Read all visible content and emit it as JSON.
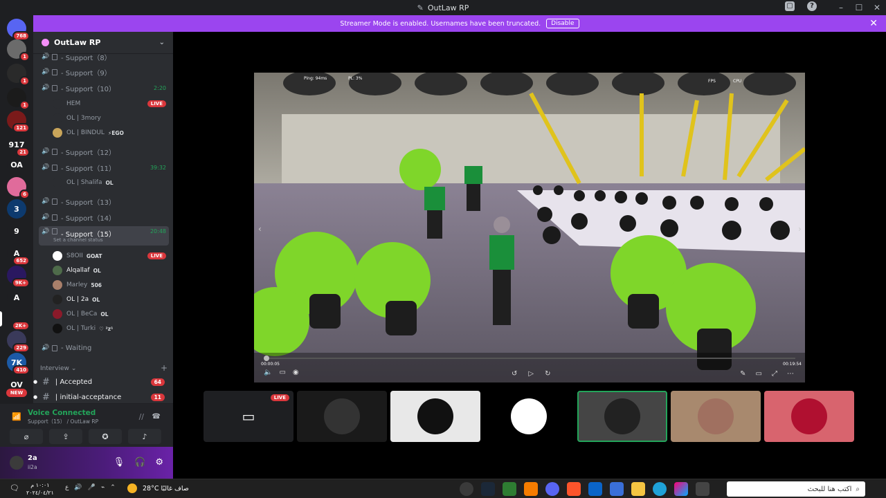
{
  "window": {
    "title": "OutLaw RP"
  },
  "banner": {
    "text": "Streamer Mode is enabled. Usernames have been truncated.",
    "disable_label": "Disable"
  },
  "rail": [
    {
      "label": "",
      "badge": "768",
      "color": "#5865f2"
    },
    {
      "label": "",
      "badge": "1",
      "color": "#6b6b6b"
    },
    {
      "label": "",
      "badge": "1",
      "color": "#2a2a2a"
    },
    {
      "label": "",
      "badge": "1",
      "color": "#1b1b1b"
    },
    {
      "label": "",
      "badge": "121",
      "color": "#7a1a1a"
    },
    {
      "label": "917",
      "badge": "21",
      "color": "#1e1f22"
    },
    {
      "label": "OA",
      "badge": "",
      "color": "#1e1f22"
    },
    {
      "label": "",
      "badge": "6",
      "color": "#e06b9b"
    },
    {
      "label": "3",
      "badge": "",
      "color": "#0d3a6e"
    },
    {
      "label": "9",
      "badge": "",
      "color": "#1e1f22"
    },
    {
      "label": "A",
      "badge": "652",
      "color": "#1e1f22"
    },
    {
      "label": "",
      "badge": "9K+",
      "color": "#2a1860"
    },
    {
      "label": "A",
      "badge": "",
      "color": "#1e1f22"
    },
    {
      "label": "",
      "badge": "2K+",
      "color": "#1e1f22"
    },
    {
      "label": "",
      "badge": "229",
      "color": "#3a3a5a"
    },
    {
      "label": "7K",
      "badge": "410",
      "color": "#1c5aa6"
    },
    {
      "label": "OV",
      "badge": "",
      "color": "#1e1f22"
    }
  ],
  "rail_new_badge": "NEW",
  "sidebar": {
    "guild_name": "OutLaw RP",
    "channels": [
      {
        "name": "- Support（8）",
        "active": false,
        "timer": ""
      },
      {
        "name": "- Support（9）",
        "active": false,
        "timer": ""
      },
      {
        "name": "- Support（10）",
        "active": false,
        "timer": "2:20"
      },
      {
        "name": "- Support（12）",
        "active": false,
        "timer": ""
      },
      {
        "name": "- Support（11）",
        "active": false,
        "timer": "39:32"
      },
      {
        "name": "- Support（13）",
        "active": false,
        "timer": ""
      },
      {
        "name": "- Support（14）",
        "active": false,
        "timer": ""
      },
      {
        "name": "- Support（15）",
        "active": true,
        "timer": "20:48",
        "status": "Set a channel status"
      },
      {
        "name": "- Waiting",
        "active": false,
        "timer": ""
      }
    ],
    "users_10": [
      {
        "name": "HEM",
        "tag": "",
        "live": "LIVE"
      },
      {
        "name": "OL | 3mory",
        "tag": "",
        "live": ""
      },
      {
        "name": "OL | BINDUL",
        "tag": "⚡EGO",
        "live": ""
      }
    ],
    "users_11": [
      {
        "name": "OL | Shalifa",
        "tag": "OL",
        "live": ""
      }
    ],
    "users_15": [
      {
        "name": "S8OII",
        "tag": "GOAT",
        "live": "LIVE"
      },
      {
        "name": "Alqallaf",
        "tag": "OL",
        "live": ""
      },
      {
        "name": "Marley",
        "tag": "506",
        "live": ""
      },
      {
        "name": "OL | 2a",
        "tag": "OL",
        "live": ""
      },
      {
        "name": "OL | BeCa",
        "tag": "OL",
        "live": ""
      },
      {
        "name": "OL | Turki",
        "tag": "♡ ²z¹",
        "live": ""
      }
    ],
    "category": "Interview",
    "text_channels": [
      {
        "name": "| Accepted",
        "count": "64"
      },
      {
        "name": "| initial-acceptance",
        "count": "11"
      }
    ]
  },
  "voice": {
    "title": "Voice Connected",
    "subtitle": "Support（15） / OutLaw RP"
  },
  "user": {
    "name": "2a",
    "status": "ii2a"
  },
  "stream": {
    "ping": "Ping: 94ms",
    "pl": "PL: 3%",
    "time_left": "00:00:05",
    "time_right": "00:19:54",
    "fps": "FPS",
    "cpu": "CPU"
  },
  "tiles": [
    {
      "type": "screen",
      "live": "LIVE",
      "color": "#1e1f22"
    },
    {
      "type": "avatar",
      "live": "",
      "color": "#1a1a1a"
    },
    {
      "type": "avatar",
      "live": "",
      "color": "#e8e8e8"
    },
    {
      "type": "avatar",
      "live": "",
      "color": "#000000"
    },
    {
      "type": "avatar",
      "live": "",
      "color": "#454545"
    },
    {
      "type": "avatar",
      "live": "",
      "color": "#a8896e"
    },
    {
      "type": "avatar",
      "live": "",
      "color": "#d8646e"
    }
  ],
  "taskbar": {
    "search_placeholder": "اكتب هنا للبحث",
    "weather": "28°C  صاف غالبًا",
    "time": "١٠:٠١ م",
    "date": "٢٠٢٤/٠٤/٢١"
  }
}
